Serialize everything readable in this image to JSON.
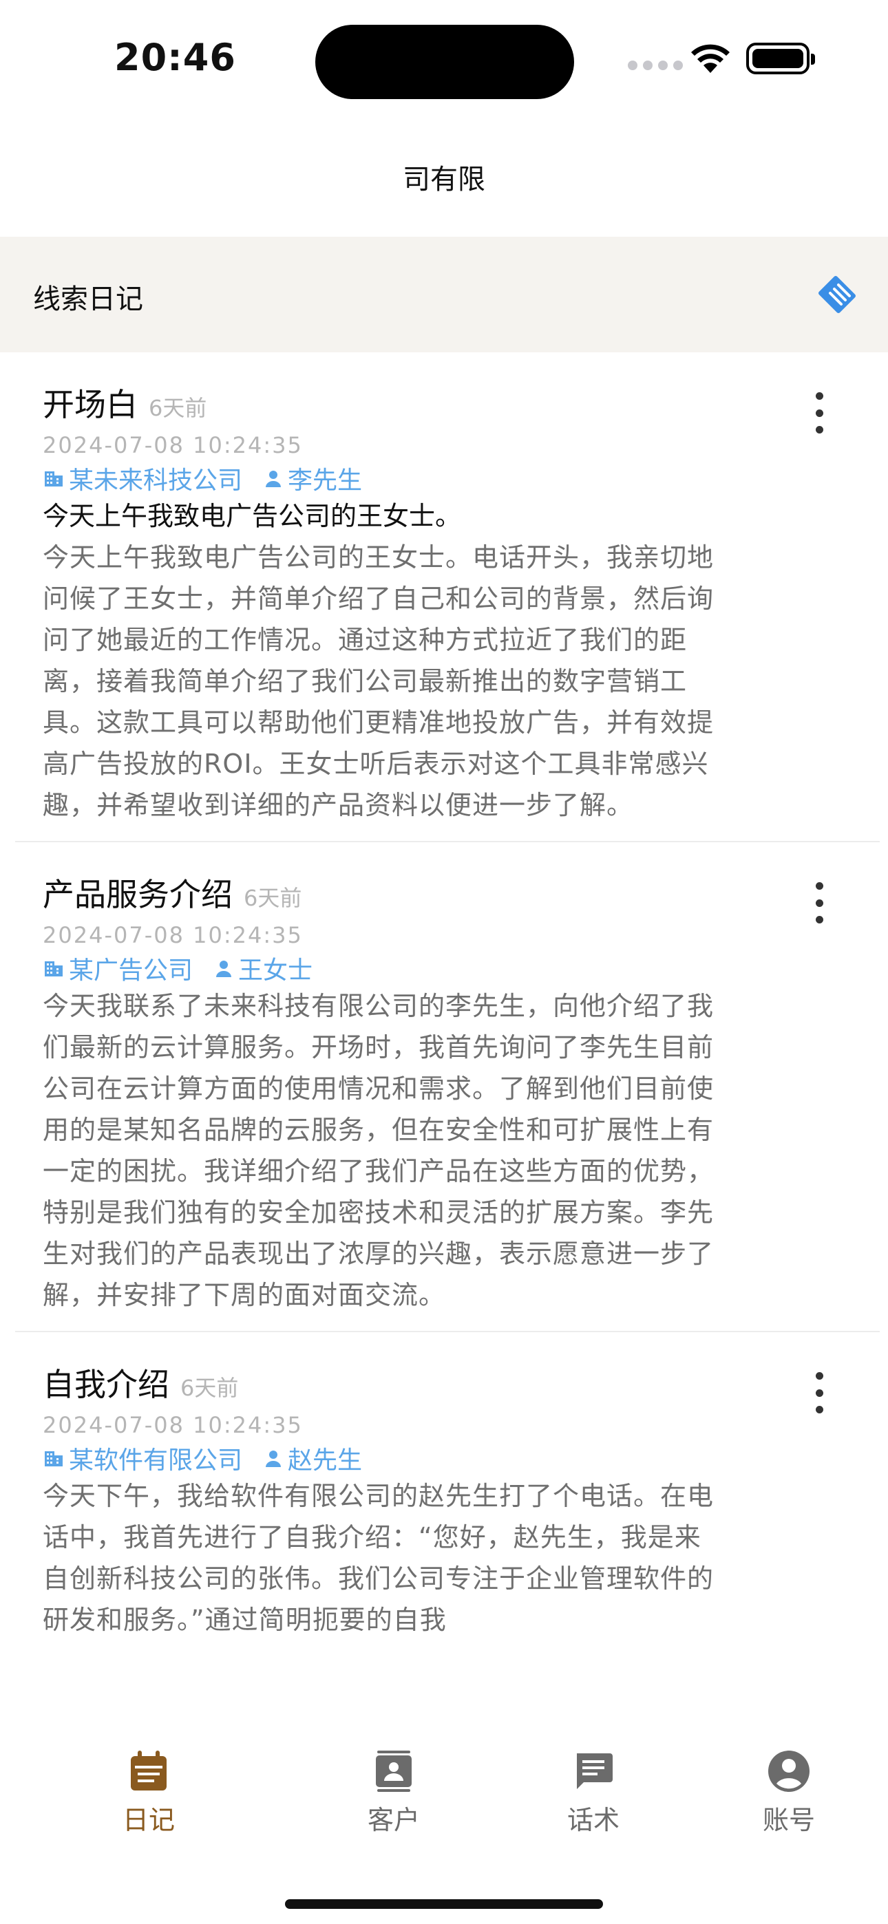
{
  "status_bar": {
    "time": "20:46"
  },
  "nav": {
    "title": "司有限"
  },
  "section": {
    "title": "线索日记",
    "action_icon": "handshake-icon"
  },
  "cards": [
    {
      "title": "开场白",
      "age": "6天前",
      "date": "2024-07-08 10:24:35",
      "company": "某未来科技公司",
      "contact": "李先生",
      "first_line": "今天上午我致电广告公司的王女士。",
      "body": "今天上午我致电广告公司的王女士。电话开头，我亲切地问候了王女士，并简单介绍了自己和公司的背景，然后询问了她最近的工作情况。通过这种方式拉近了我们的距离，接着我简单介绍了我们公司最新推出的数字营销工具。这款工具可以帮助他们更精准地投放广告，并有效提高广告投放的ROI。王女士听后表示对这个工具非常感兴趣，并希望收到详细的产品资料以便进一步了解。"
    },
    {
      "title": "产品服务介绍",
      "age": "6天前",
      "date": "2024-07-08 10:24:35",
      "company": "某广告公司",
      "contact": "王女士",
      "first_line": "",
      "body": "今天我联系了未来科技有限公司的李先生，向他介绍了我们最新的云计算服务。开场时，我首先询问了李先生目前公司在云计算方面的使用情况和需求。了解到他们目前使用的是某知名品牌的云服务，但在安全性和可扩展性上有一定的困扰。我详细介绍了我们产品在这些方面的优势，特别是我们独有的安全加密技术和灵活的扩展方案。李先生对我们的产品表现出了浓厚的兴趣，表示愿意进一步了解，并安排了下周的面对面交流。"
    },
    {
      "title": "自我介绍",
      "age": "6天前",
      "date": "2024-07-08 10:24:35",
      "company": "某软件有限公司",
      "contact": "赵先生",
      "first_line": "",
      "body": "今天下午，我给软件有限公司的赵先生打了个电话。在电话中，我首先进行了自我介绍：“您好，赵先生，我是来自创新科技公司的张伟。我们公司专注于企业管理软件的研发和服务。”通过简明扼要的自我"
    }
  ],
  "tabs": [
    {
      "label": "日记",
      "icon": "calendar-icon",
      "active": true
    },
    {
      "label": "客户",
      "icon": "contacts-icon",
      "active": false
    },
    {
      "label": "话术",
      "icon": "chat-icon",
      "active": false
    },
    {
      "label": "账号",
      "icon": "account-icon",
      "active": false
    }
  ],
  "colors": {
    "accent": "#8a5a1f",
    "link": "#5aa5e8",
    "header_bg": "#f5f3ef",
    "icon_blue": "#3a8ee6"
  }
}
